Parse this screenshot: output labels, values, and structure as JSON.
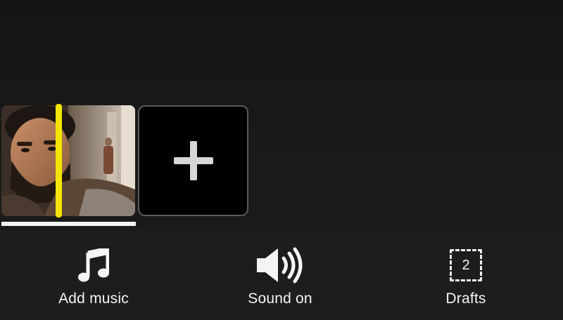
{
  "timeline": {
    "clips": [
      {
        "thumbnail": "bearded-man-video-frame"
      }
    ],
    "add_clip_icon": "plus-icon",
    "playhead_color": "#f3e500"
  },
  "bottom_bar": {
    "items": [
      {
        "label": "Add music",
        "icon": "music-note-icon"
      },
      {
        "label": "Sound on",
        "icon": "speaker-icon"
      },
      {
        "label": "Drafts",
        "icon": "drafts-icon",
        "count": "2"
      }
    ]
  },
  "colors": {
    "background": "#141414",
    "bar_background": "#1d1d1d",
    "text": "#f4f4f4",
    "accent": "#f3e500"
  }
}
